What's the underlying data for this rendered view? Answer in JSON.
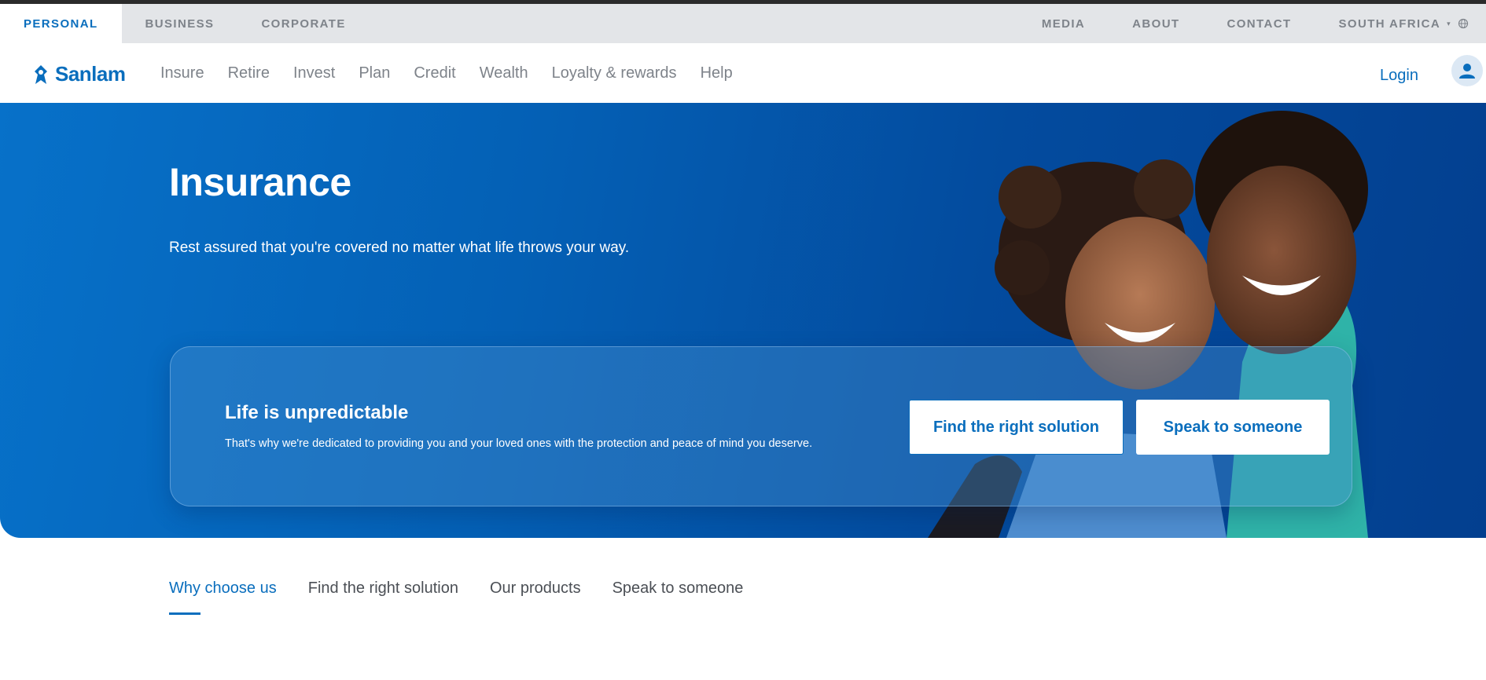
{
  "utility_bar": {
    "tabs": [
      {
        "label": "PERSONAL",
        "active": true
      },
      {
        "label": "BUSINESS",
        "active": false
      },
      {
        "label": "CORPORATE",
        "active": false
      }
    ],
    "links": [
      "MEDIA",
      "ABOUT",
      "CONTACT"
    ],
    "region": {
      "label": "SOUTH AFRICA",
      "icons": [
        "caret-down-icon",
        "globe-icon"
      ]
    }
  },
  "main_nav": {
    "logo_text": "Sanlam",
    "logo_icon": "sanlam-logo-icon",
    "items": [
      "Insure",
      "Retire",
      "Invest",
      "Plan",
      "Credit",
      "Wealth",
      "Loyalty & rewards",
      "Help"
    ],
    "login_label": "Login",
    "avatar_icon": "user-icon"
  },
  "hero": {
    "title": "Insurance",
    "subtitle": "Rest assured that you're covered no matter what life throws your way.",
    "card": {
      "title": "Life is unpredictable",
      "text": "That's why we're dedicated to providing you and your loved ones with the protection and peace of mind you deserve.",
      "primary_button": "Find the right solution",
      "secondary_button": "Speak to someone"
    }
  },
  "section_tabs": {
    "items": [
      {
        "label": "Why choose us",
        "active": true
      },
      {
        "label": "Find the right solution",
        "active": false
      },
      {
        "label": "Our products",
        "active": false
      },
      {
        "label": "Speak to someone",
        "active": false
      }
    ]
  },
  "colors": {
    "brand_blue": "#0a6ebd",
    "hero_gradient_start": "#0771c9",
    "hero_gradient_end": "#033f8f",
    "utility_bar_bg": "#e3e5e8",
    "muted_text": "#7e838a"
  }
}
